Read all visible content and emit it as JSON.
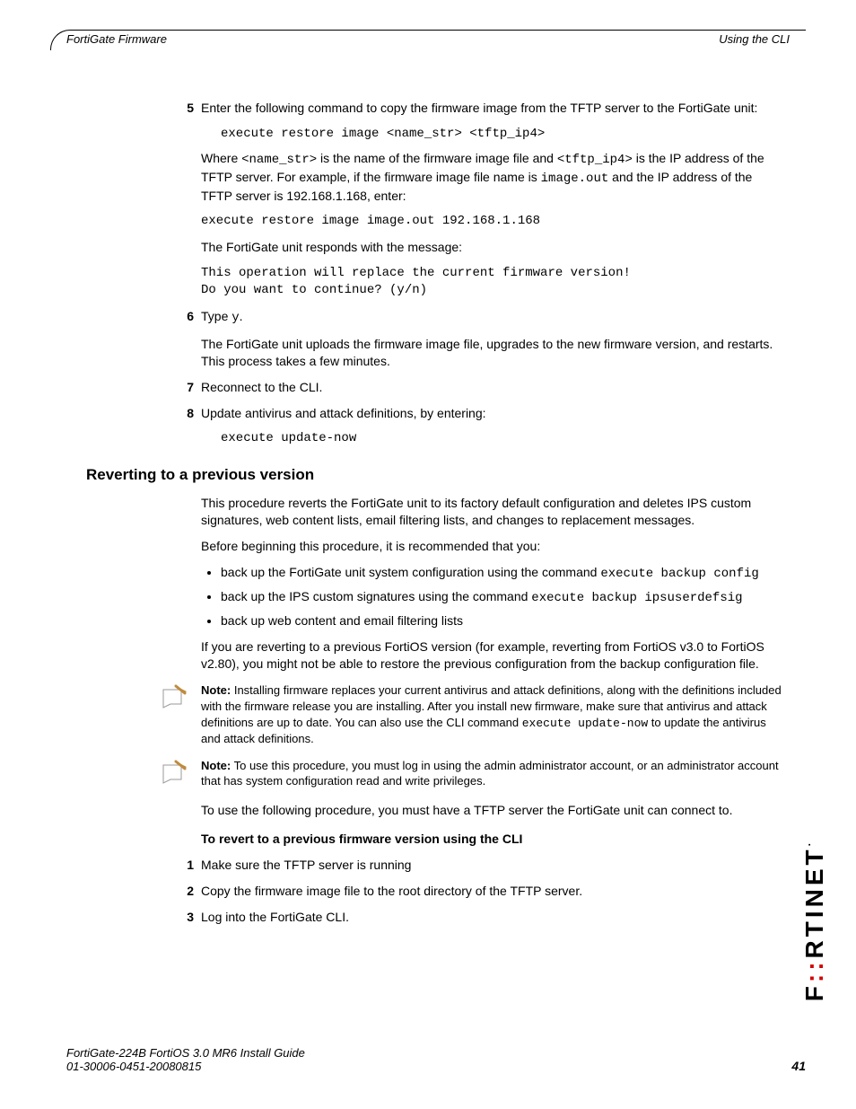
{
  "header": {
    "left": "FortiGate Firmware",
    "right": "Using the CLI"
  },
  "steps_a": [
    {
      "num": "5",
      "text": "Enter the following command to copy the firmware image from the TFTP server to the FortiGate unit:"
    }
  ],
  "cmd1": "execute restore image <name_str> <tftp_ip4>",
  "para_where_a": "Where ",
  "para_where_b": "<name_str>",
  "para_where_c": " is the name of the firmware image file and ",
  "para_where_d": "<tftp_ip4>",
  "para_where_e": " is the IP address of the TFTP server. For example, if the firmware image file name is ",
  "para_where_f": "image.out",
  "para_where_g": " and the IP address of the TFTP server is 192.168.1.168, enter:",
  "cmd2": "execute restore image image.out 192.168.1.168",
  "para_responds": "The FortiGate unit responds with the message:",
  "cmd3": "This operation will replace the current firmware version!\nDo you want to continue? (y/n)",
  "step6": {
    "num": "6",
    "prefix": "Type ",
    "code": "y",
    "suffix": "."
  },
  "para_upload": "The FortiGate unit uploads the firmware image file, upgrades to the new firmware version, and restarts. This process takes a few minutes.",
  "step7": {
    "num": "7",
    "text": "Reconnect to the CLI."
  },
  "step8": {
    "num": "8",
    "text": "Update antivirus and attack definitions, by entering:"
  },
  "cmd4": "execute update-now",
  "section_title": "Reverting to a previous version",
  "revert_intro": "This procedure reverts the FortiGate unit to its factory default configuration and deletes IPS custom signatures, web content lists, email filtering lists, and changes to replacement messages.",
  "revert_before": "Before beginning this procedure, it is recommended that you:",
  "bullets": {
    "b1a": "back up the FortiGate unit system configuration using the command ",
    "b1b": "execute backup config",
    "b2a": "back up the IPS custom signatures using the command ",
    "b2b": "execute backup ipsuserdefsig",
    "b3": "back up web content and email filtering lists"
  },
  "revert_if": "If you are reverting to a previous FortiOS version (for example, reverting from FortiOS v3.0 to FortiOS v2.80), you might not be able to restore the previous configuration from the backup configuration file.",
  "note1": {
    "label": "Note:",
    "a": " Installing firmware replaces your current antivirus and attack definitions, along with the definitions included with the firmware release you are installing. After you install new firmware, make sure that antivirus and attack definitions are up to date. You can also use the CLI command ",
    "code": "execute update-now",
    "b": " to update the antivirus and attack definitions."
  },
  "note2": {
    "label": "Note:",
    "text": " To use this procedure, you must log in using the admin administrator account, or an administrator account that has system configuration read and write privileges."
  },
  "revert_tftp": "To use the following procedure, you must have a TFTP server the FortiGate unit can connect to.",
  "proc_head": "To revert to a previous firmware version using the CLI",
  "steps_b": [
    {
      "num": "1",
      "text": "Make sure the TFTP server is running"
    },
    {
      "num": "2",
      "text": "Copy the firmware image file to the root directory of the TFTP server."
    },
    {
      "num": "3",
      "text": "Log into the FortiGate CLI."
    }
  ],
  "footer": {
    "line1": "FortiGate-224B FortiOS 3.0 MR6 Install Guide",
    "line2": "01-30006-0451-20080815",
    "pagenum": "41"
  },
  "logo": {
    "a": "F",
    "b": "::",
    "c": "RTINET",
    "dot": "."
  }
}
